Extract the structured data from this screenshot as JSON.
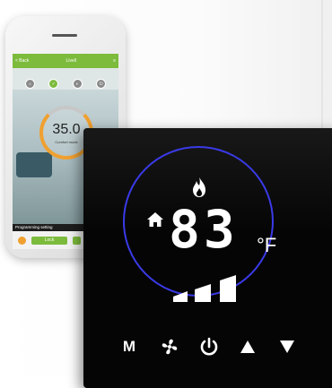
{
  "phone_app": {
    "header_left": "< Back",
    "header_title": "Livell",
    "current_temp": "35.0",
    "temp_caption": "Comfort mode",
    "programming_label": "Programming setting",
    "lock_label": "Lock",
    "colors": {
      "accent": "#7cbb3c",
      "dial": "#f0a030"
    }
  },
  "thermostat": {
    "temperature": "83",
    "unit": "°F",
    "mode_label": "M",
    "icons": {
      "flame": "flame-icon",
      "home": "home-icon",
      "fan": "fan-icon",
      "power": "power-icon",
      "up": "arrow-up-icon",
      "down": "arrow-down-icon",
      "level": "fan-speed-bars-icon"
    },
    "fan_level": 3,
    "colors": {
      "ring": "#3a3ae8",
      "panel": "#050505"
    }
  }
}
